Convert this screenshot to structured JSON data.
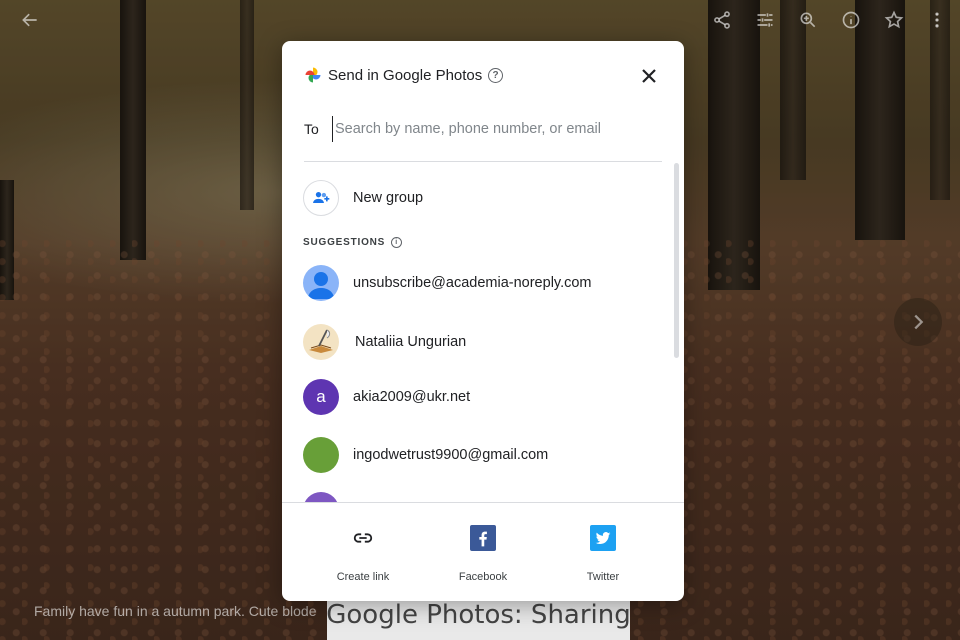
{
  "topbar": {
    "icons": [
      "back-arrow-icon",
      "share-icon",
      "edit-icon",
      "zoom-in-icon",
      "info-icon",
      "star-icon",
      "more-icon"
    ]
  },
  "photo_caption": "Family have fun in a autumn park. Cute blode",
  "overlay_title": "Google Photos: Sharing",
  "dialog": {
    "title": "Send in Google Photos",
    "help_symbol": "?",
    "to_label": "To",
    "search_placeholder": "Search by name, phone number, or email",
    "new_group_label": "New group",
    "suggestions_label": "SUGGESTIONS",
    "suggestions": [
      {
        "label": "unsubscribe@academia-noreply.com",
        "avatar": "person",
        "color": "#8ab4f8"
      },
      {
        "label": "Nataliia Ungurian",
        "avatar": "image",
        "color": "#f3e3c3"
      },
      {
        "label": "akia2009@ukr.net",
        "avatar": "a",
        "color": "#5e35b1"
      },
      {
        "label": "ingodwetrust9900@gmail.com",
        "avatar": "",
        "color": "#689f38"
      },
      {
        "label": "",
        "avatar": "",
        "color": "#7e57c2"
      }
    ],
    "share_options": [
      {
        "label": "Create link",
        "icon": "link-icon"
      },
      {
        "label": "Facebook",
        "icon": "facebook-icon",
        "color": "#3b5998"
      },
      {
        "label": "Twitter",
        "icon": "twitter-icon",
        "color": "#1da1f2"
      }
    ]
  }
}
